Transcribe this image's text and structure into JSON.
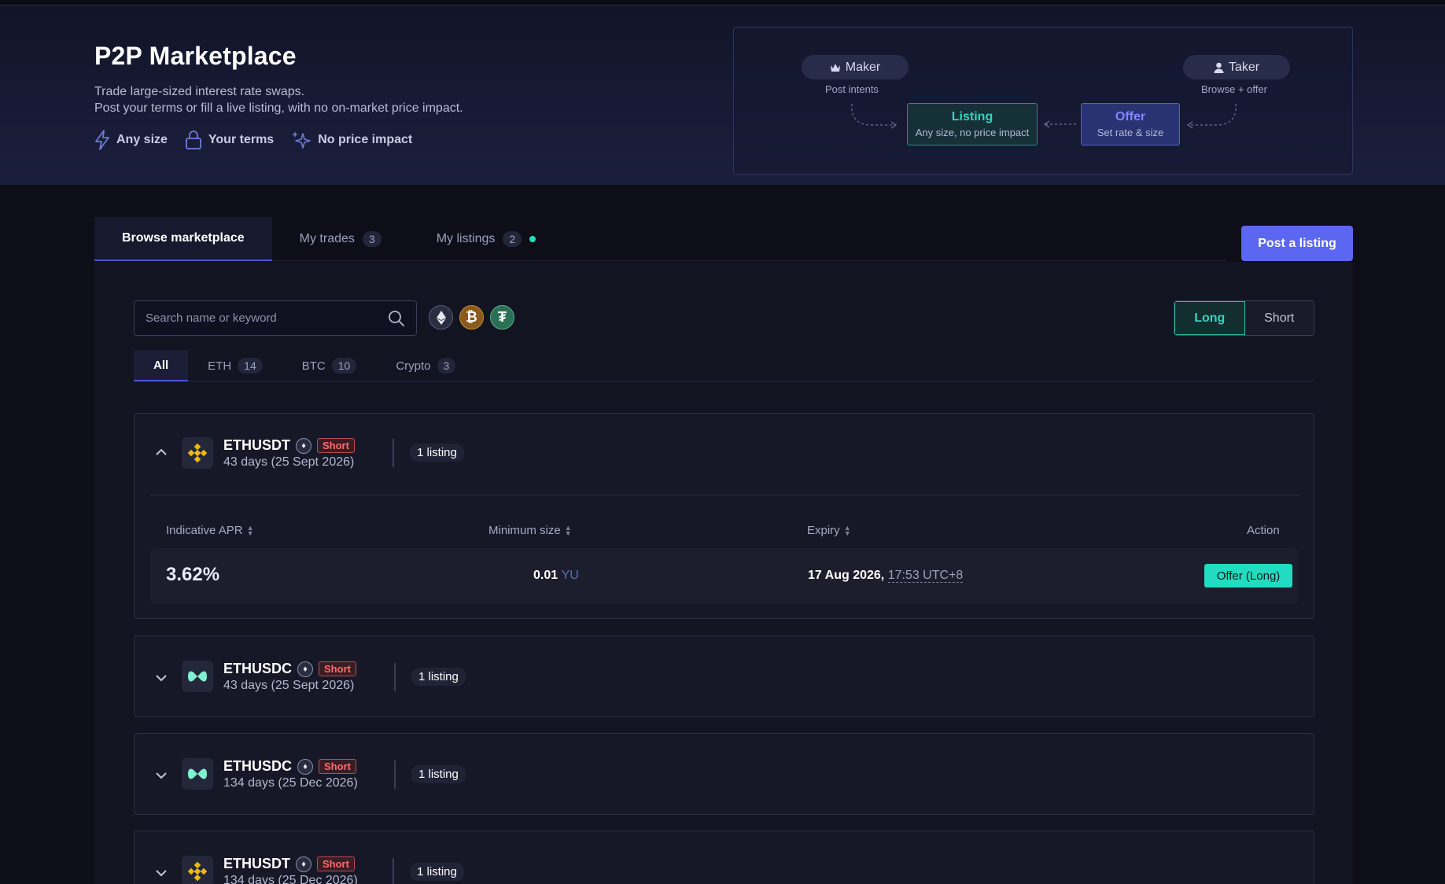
{
  "hero": {
    "title": "P2P Marketplace",
    "subtitle_line1": "Trade large-sized interest rate swaps.",
    "subtitle_line2": "Post your terms or fill a live listing, with no on-market price impact.",
    "features": [
      {
        "icon": "bolt-icon",
        "label": "Any size"
      },
      {
        "icon": "lock-icon",
        "label": "Your terms"
      },
      {
        "icon": "sparkle-icon",
        "label": "No price impact"
      }
    ]
  },
  "flow": {
    "maker": {
      "label": "Maker",
      "caption": "Post intents",
      "icon": "crown-icon"
    },
    "taker": {
      "label": "Taker",
      "caption": "Browse + offer",
      "icon": "user-icon"
    },
    "listing": {
      "title": "Listing",
      "subtitle": "Any size, no price impact"
    },
    "offer": {
      "title": "Offer",
      "subtitle": "Set rate & size"
    }
  },
  "tabs": [
    {
      "label": "Browse marketplace",
      "active": true
    },
    {
      "label": "My trades",
      "count": "3"
    },
    {
      "label": "My listings",
      "count": "2"
    }
  ],
  "post_button": "Post a listing",
  "search": {
    "placeholder": "Search name or keyword"
  },
  "coins": [
    "ethereum-icon",
    "bitcoin-icon",
    "tether-icon"
  ],
  "direction": {
    "long": "Long",
    "short": "Short",
    "selected": "Long"
  },
  "filters": [
    {
      "label": "All",
      "active": true
    },
    {
      "label": "ETH",
      "count": "14"
    },
    {
      "label": "BTC",
      "count": "10"
    },
    {
      "label": "Crypto",
      "count": "3"
    }
  ],
  "markets": [
    {
      "pair": "ETHUSDT",
      "side": "Short",
      "term": "43 days (25 Sept 2026)",
      "listings": "1 listing",
      "expanded": true,
      "exchange_icon": "binance-icon",
      "columns": {
        "apr": "Indicative APR",
        "min_size": "Minimum size",
        "expiry": "Expiry",
        "action": "Action"
      },
      "rows": [
        {
          "apr": "3.62%",
          "min_size": "0.01",
          "min_unit": "YU",
          "expiry_date": "17 Aug 2026,",
          "expiry_time": "17:53 UTC+8",
          "action": "Offer (Long)"
        }
      ]
    },
    {
      "pair": "ETHUSDC",
      "side": "Short",
      "term": "43 days (25 Sept 2026)",
      "listings": "1 listing",
      "exchange_icon": "hyperliquid-icon"
    },
    {
      "pair": "ETHUSDC",
      "side": "Short",
      "term": "134 days (25 Dec 2026)",
      "listings": "1 listing",
      "exchange_icon": "hyperliquid-icon"
    },
    {
      "pair": "ETHUSDT",
      "side": "Short",
      "term": "134 days (25 Dec 2026)",
      "listings": "1 listing",
      "exchange_icon": "binance-icon"
    }
  ],
  "colors": {
    "accent": "#5b67f0",
    "teal": "#21dcc0",
    "short": "#ff6b6b",
    "background": "#0d0e17"
  }
}
